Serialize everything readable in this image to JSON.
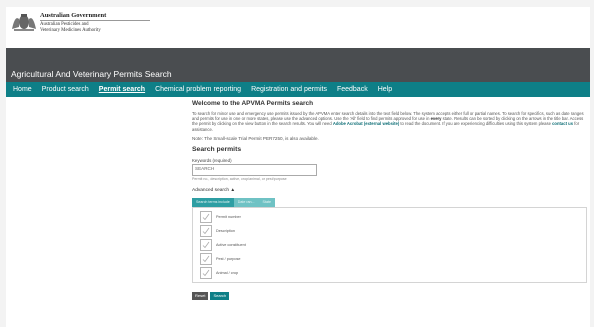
{
  "header": {
    "gov_line1": "Australian Government",
    "gov_line2": "Australian Pesticides and",
    "gov_line3": "Veterinary Medicines Authority"
  },
  "banner": {
    "title": "Agricultural And Veterinary Permits Search"
  },
  "nav": {
    "items": [
      {
        "label": "Home"
      },
      {
        "label": "Product search"
      },
      {
        "label": "Permit search"
      },
      {
        "label": "Chemical problem reporting"
      },
      {
        "label": "Registration and permits"
      },
      {
        "label": "Feedback"
      },
      {
        "label": "Help"
      }
    ],
    "active": "Permit search"
  },
  "main": {
    "heading": "Welcome to the APVMA Permits search",
    "intro_a": "To search for minor use and emergency use permits issued by the APVMA enter search details into the text field below. The system accepts either full or partial names. To search for specifics, such as date ranges and permits for use in one or more states, please use the advanced options. Use the 'All' field to find permits approved for use in ",
    "intro_bold": "every",
    "intro_b": " state. Results can be sorted by clicking on the arrows in the title bar. Access the permit by clicking on the view button in the search results. You will need ",
    "intro_link1": "Adobe Acrobat (external website)",
    "intro_c": " to read the document. If you are experiencing difficulties using this system please ",
    "intro_link2": "contact us",
    "intro_d": " for assistance.",
    "note": "Note: The Small-scale Trial Permit PER7250, is also available.",
    "search_heading": "Search permits",
    "keywords_label": "Keywords (required)",
    "search_value": "SEARCH",
    "hint": "Permit no., description, active, crop/animal, or pest/purpose",
    "advanced_label": "Advanced search ▲",
    "tabs": [
      {
        "label": "Search terms include"
      },
      {
        "label": "Date ran..."
      },
      {
        "label": "State"
      }
    ],
    "criteria": [
      {
        "label": "Permit number"
      },
      {
        "label": "Description"
      },
      {
        "label": "Active constituent"
      },
      {
        "label": "Pest / purpose"
      },
      {
        "label": "Animal / crop"
      }
    ],
    "reset_label": "Reset",
    "search_label": "Search"
  },
  "colors": {
    "nav_teal": "#0e7f87",
    "banner_gray": "#4a4d50",
    "tab_active": "#2e9ea3",
    "tab_inactive": "#6fc2c4"
  }
}
